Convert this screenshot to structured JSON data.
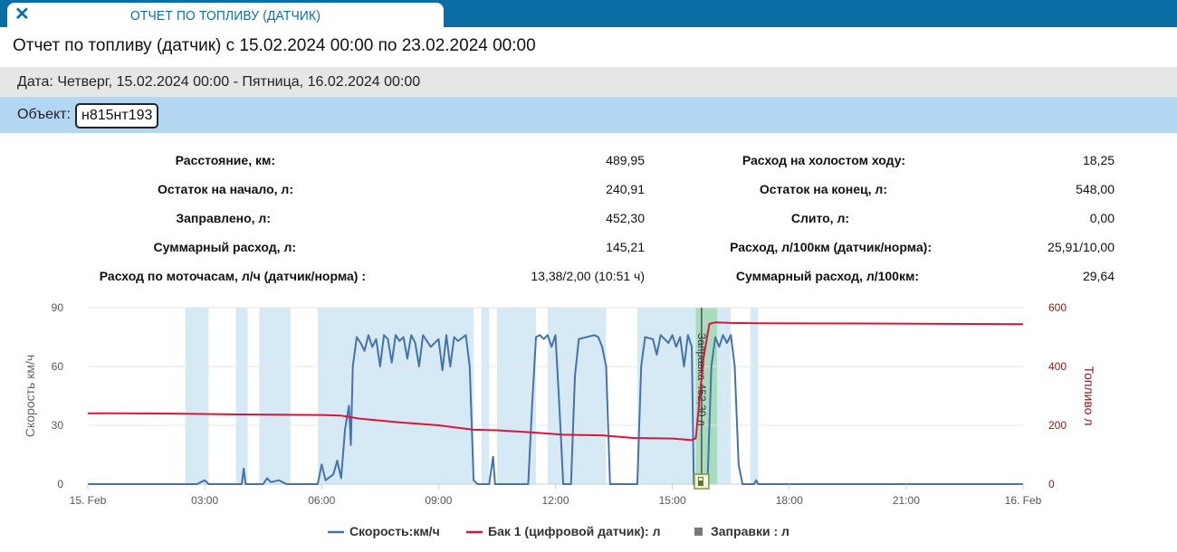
{
  "tab": {
    "close_icon": "close-icon",
    "title": "ОТЧЕТ ПО ТОПЛИВУ (ДАТЧИК)"
  },
  "report_title": "Отчет по топливу (датчик) с 15.02.2024 00:00 по 23.02.2024 00:00",
  "date_line": "Дата: Четверг, 15.02.2024 00:00 - Пятница, 16.02.2024 00:00",
  "object": {
    "label": "Объект:",
    "value": "н815нт193"
  },
  "stats_left": [
    {
      "label": "Расстояние, км:",
      "value": "489,95"
    },
    {
      "label": "Остаток на начало, л:",
      "value": "240,91"
    },
    {
      "label": "Заправлено, л:",
      "value": "452,30"
    },
    {
      "label": "Суммарный расход, л:",
      "value": "145,21"
    },
    {
      "label": "Расход по моточасам, л/ч (датчик/норма) :",
      "value": "13,38/2,00 (10:51 ч)"
    }
  ],
  "stats_right": [
    {
      "label": "Расход на холостом ходу:",
      "value": "18,25"
    },
    {
      "label": "Остаток на конец, л:",
      "value": "548,00"
    },
    {
      "label": "Слито, л:",
      "value": "0,00"
    },
    {
      "label": "Расход, л/100км (датчик/норма):",
      "value": "25,91/10,00"
    },
    {
      "label": "Суммарный расход, л/100км:",
      "value": "29,64"
    }
  ],
  "colors": {
    "speed": "#4572a7",
    "fuel": "#dc143c",
    "motion_band": "#d6eaf5",
    "refuel_band": "#a9dbbf",
    "header": "#0a6ea5"
  },
  "chart_data": {
    "type": "line",
    "x_unit": "hours since 15.02.2024 00:00",
    "x_ticks": [
      {
        "h": 0,
        "label": "15. Feb"
      },
      {
        "h": 3,
        "label": "03:00"
      },
      {
        "h": 6,
        "label": "06:00"
      },
      {
        "h": 9,
        "label": "09:00"
      },
      {
        "h": 12,
        "label": "12:00"
      },
      {
        "h": 15,
        "label": "15:00"
      },
      {
        "h": 18,
        "label": "18:00"
      },
      {
        "h": 21,
        "label": "21:00"
      },
      {
        "h": 24,
        "label": "16. Feb"
      }
    ],
    "xlim": [
      0,
      24
    ],
    "y_left": {
      "label": "Скорость км/ч",
      "ticks": [
        "0",
        "30",
        "60",
        "90"
      ],
      "lim": [
        0,
        90
      ]
    },
    "y_right": {
      "label": "Топливо л",
      "ticks": [
        "0",
        "200",
        "400",
        "600"
      ],
      "lim": [
        0,
        600
      ]
    },
    "motion_intervals": [
      [
        2.5,
        3.1
      ],
      [
        3.8,
        4.1
      ],
      [
        4.4,
        5.2
      ],
      [
        5.9,
        9.9
      ],
      [
        10.1,
        10.3
      ],
      [
        10.5,
        11.5
      ],
      [
        11.8,
        13.3
      ],
      [
        14.1,
        16.5
      ],
      [
        17.0,
        17.2
      ]
    ],
    "refuel_interval": [
      15.6,
      16.15
    ],
    "refuel_label": "Заправка 452,30 л",
    "series": [
      {
        "name": "Скорость:км/ч",
        "axis": "left",
        "points": [
          [
            0,
            0
          ],
          [
            2.8,
            0
          ],
          [
            2.9,
            1
          ],
          [
            3.0,
            2
          ],
          [
            3.1,
            0
          ],
          [
            3.95,
            0
          ],
          [
            4.0,
            8
          ],
          [
            4.05,
            0
          ],
          [
            4.5,
            0
          ],
          [
            4.6,
            3
          ],
          [
            4.7,
            1
          ],
          [
            4.9,
            2
          ],
          [
            5.1,
            0
          ],
          [
            5.9,
            0
          ],
          [
            6.0,
            10
          ],
          [
            6.1,
            2
          ],
          [
            6.3,
            5
          ],
          [
            6.4,
            12
          ],
          [
            6.5,
            3
          ],
          [
            6.6,
            28
          ],
          [
            6.7,
            40
          ],
          [
            6.75,
            20
          ],
          [
            6.8,
            60
          ],
          [
            6.9,
            75
          ],
          [
            7.0,
            72
          ],
          [
            7.1,
            68
          ],
          [
            7.2,
            76
          ],
          [
            7.3,
            70
          ],
          [
            7.4,
            74
          ],
          [
            7.5,
            60
          ],
          [
            7.6,
            76
          ],
          [
            7.7,
            74
          ],
          [
            7.8,
            62
          ],
          [
            7.9,
            76
          ],
          [
            8.0,
            73
          ],
          [
            8.1,
            75
          ],
          [
            8.2,
            64
          ],
          [
            8.3,
            76
          ],
          [
            8.4,
            72
          ],
          [
            8.5,
            60
          ],
          [
            8.6,
            76
          ],
          [
            8.8,
            70
          ],
          [
            9.0,
            74
          ],
          [
            9.1,
            58
          ],
          [
            9.2,
            76
          ],
          [
            9.3,
            60
          ],
          [
            9.4,
            75
          ],
          [
            9.5,
            73
          ],
          [
            9.7,
            76
          ],
          [
            9.8,
            60
          ],
          [
            9.9,
            2
          ],
          [
            10.0,
            0
          ],
          [
            10.3,
            0
          ],
          [
            10.4,
            14
          ],
          [
            10.45,
            0
          ],
          [
            11.3,
            0
          ],
          [
            11.4,
            40
          ],
          [
            11.5,
            75
          ],
          [
            11.6,
            76
          ],
          [
            11.7,
            74
          ],
          [
            11.8,
            76
          ],
          [
            11.9,
            70
          ],
          [
            12.0,
            76
          ],
          [
            12.1,
            40
          ],
          [
            12.2,
            0
          ],
          [
            12.4,
            0
          ],
          [
            12.5,
            55
          ],
          [
            12.6,
            74
          ],
          [
            12.8,
            75
          ],
          [
            13.0,
            76
          ],
          [
            13.1,
            75
          ],
          [
            13.2,
            70
          ],
          [
            13.3,
            60
          ],
          [
            13.4,
            0
          ],
          [
            14.1,
            0
          ],
          [
            14.2,
            60
          ],
          [
            14.3,
            75
          ],
          [
            14.5,
            74
          ],
          [
            14.6,
            66
          ],
          [
            14.7,
            76
          ],
          [
            14.9,
            72
          ],
          [
            15.0,
            76
          ],
          [
            15.1,
            70
          ],
          [
            15.2,
            75
          ],
          [
            15.3,
            60
          ],
          [
            15.4,
            76
          ],
          [
            15.5,
            70
          ],
          [
            15.55,
            0
          ],
          [
            15.9,
            0
          ],
          [
            16.0,
            60
          ],
          [
            16.1,
            75
          ],
          [
            16.2,
            70
          ],
          [
            16.3,
            76
          ],
          [
            16.4,
            72
          ],
          [
            16.5,
            76
          ],
          [
            16.6,
            60
          ],
          [
            16.7,
            10
          ],
          [
            16.8,
            0
          ],
          [
            17.1,
            0
          ],
          [
            17.15,
            2
          ],
          [
            17.2,
            0
          ],
          [
            24,
            0
          ]
        ]
      },
      {
        "name": "Бак 1 (цифровой датчик): л",
        "axis": "right",
        "points": [
          [
            0,
            241
          ],
          [
            2,
            240
          ],
          [
            4,
            237
          ],
          [
            6,
            235
          ],
          [
            6.5,
            233
          ],
          [
            7,
            222
          ],
          [
            8,
            210
          ],
          [
            9,
            200
          ],
          [
            9.9,
            185
          ],
          [
            10.5,
            183
          ],
          [
            11.5,
            175
          ],
          [
            12.2,
            168
          ],
          [
            13.2,
            166
          ],
          [
            14,
            157
          ],
          [
            15,
            155
          ],
          [
            15.5,
            150
          ],
          [
            15.6,
            156
          ],
          [
            15.8,
            430
          ],
          [
            15.95,
            545
          ],
          [
            16.1,
            550
          ],
          [
            16.5,
            548
          ],
          [
            17.2,
            547
          ],
          [
            20,
            546
          ],
          [
            24,
            544
          ]
        ]
      },
      {
        "name": "Заправки : л",
        "axis": "right",
        "points": [
          [
            15.75,
            0
          ]
        ]
      }
    ],
    "legend_position": "bottom-center"
  }
}
